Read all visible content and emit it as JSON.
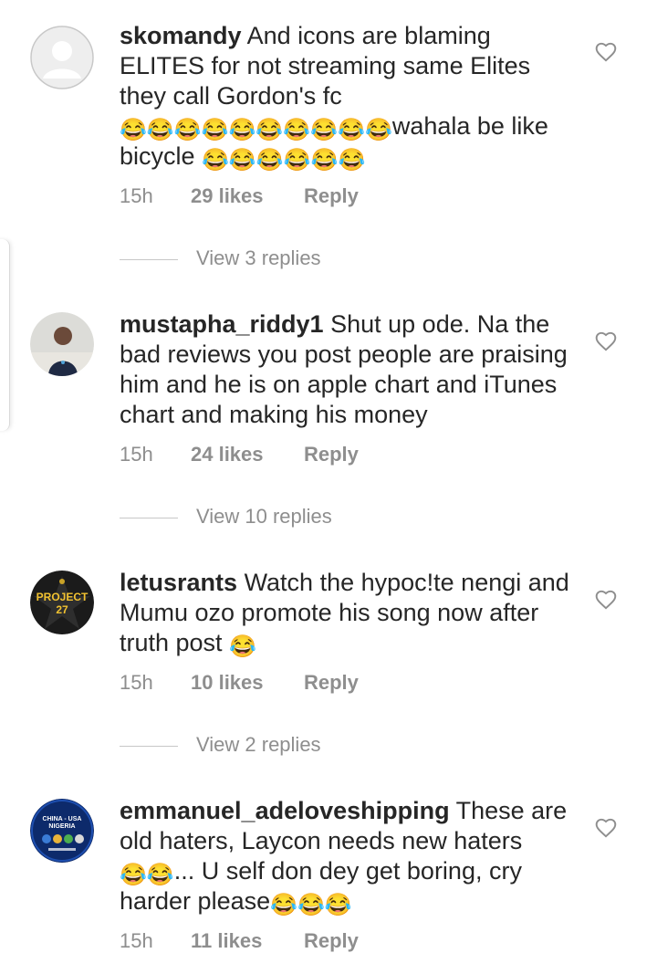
{
  "comments": [
    {
      "username": "skomandy",
      "text": "And icons are blaming ELITES for not streaming same Elites they call Gordon's fc",
      "emoji_a": "😂😂😂😂😂😂😂😂😂😂",
      "text_b": "wahala be like bicycle ",
      "emoji_b": "😂😂😂😂😂😂",
      "time": "15h",
      "likes": "29 likes",
      "reply": "Reply",
      "view_replies": "View 3 replies",
      "avatar": "default-avatar"
    },
    {
      "username": "mustapha_riddy1",
      "text": "Shut up ode.  Na the bad reviews you post people are praising him and he is on apple chart and iTunes chart and making his money",
      "time": "15h",
      "likes": "24 likes",
      "reply": "Reply",
      "view_replies": "View 10 replies",
      "avatar": "photo-avatar"
    },
    {
      "username": "letusrants",
      "text": "Watch the hypoc!te nengi and Mumu ozo promote his song now after truth post ",
      "emoji_a": "😂",
      "time": "15h",
      "likes": "10 likes",
      "reply": "Reply",
      "view_replies": "View 2 replies",
      "avatar_text_1": "PROJECT",
      "avatar_text_2": "27"
    },
    {
      "username": "emmanuel_adeloveshipping",
      "text": "These are old haters, Laycon needs new haters ",
      "emoji_a": "😂😂",
      "text_b": "... U self don dey get boring, cry harder please",
      "emoji_b": "😂😂😂",
      "time": "15h",
      "likes": "11 likes",
      "reply": "Reply",
      "avatar_text_1": "CHINA - USA",
      "avatar_text_2": "NIGERIA"
    }
  ],
  "colors": {
    "text": "#262626",
    "muted": "#8e8e8e",
    "background": "#ffffff"
  },
  "icons": {
    "like": "heart-outline-icon"
  }
}
